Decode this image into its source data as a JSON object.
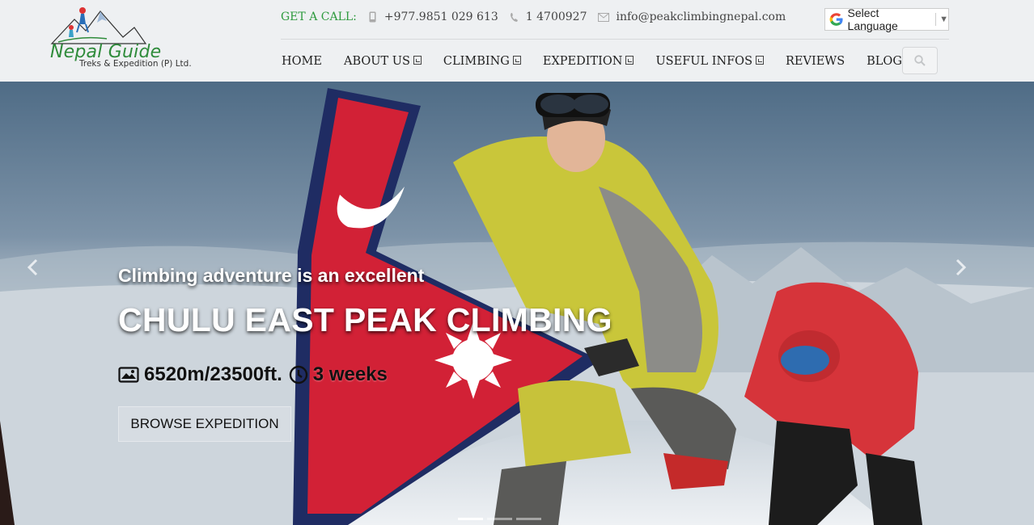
{
  "brand": {
    "name": "Nepal Guide",
    "subtitle": "Treks & Expedition (P) Ltd."
  },
  "topbar": {
    "call_label": "GET A CALL:",
    "mobile": "+977.9851 029 613",
    "phone": "1 4700927",
    "email": "info@peakclimbingnepal.com"
  },
  "language": {
    "label": "Select Language"
  },
  "nav": {
    "items": [
      {
        "label": "HOME"
      },
      {
        "label": "ABOUT US"
      },
      {
        "label": "CLIMBING"
      },
      {
        "label": "EXPEDITION"
      },
      {
        "label": "USEFUL INFOS"
      },
      {
        "label": "REVIEWS"
      },
      {
        "label": "BLOG"
      }
    ]
  },
  "hero": {
    "subtitle": "Climbing adventure is an excellent",
    "title": "CHULU EAST PEAK CLIMBING",
    "altitude": "6520m/23500ft.",
    "duration": "3 weeks",
    "button": "BROWSE EXPEDITION",
    "slides_total": 3,
    "active_slide": 1
  },
  "colors": {
    "brand_green": "#2e8b3a",
    "header_bg": "#eef0f2"
  }
}
